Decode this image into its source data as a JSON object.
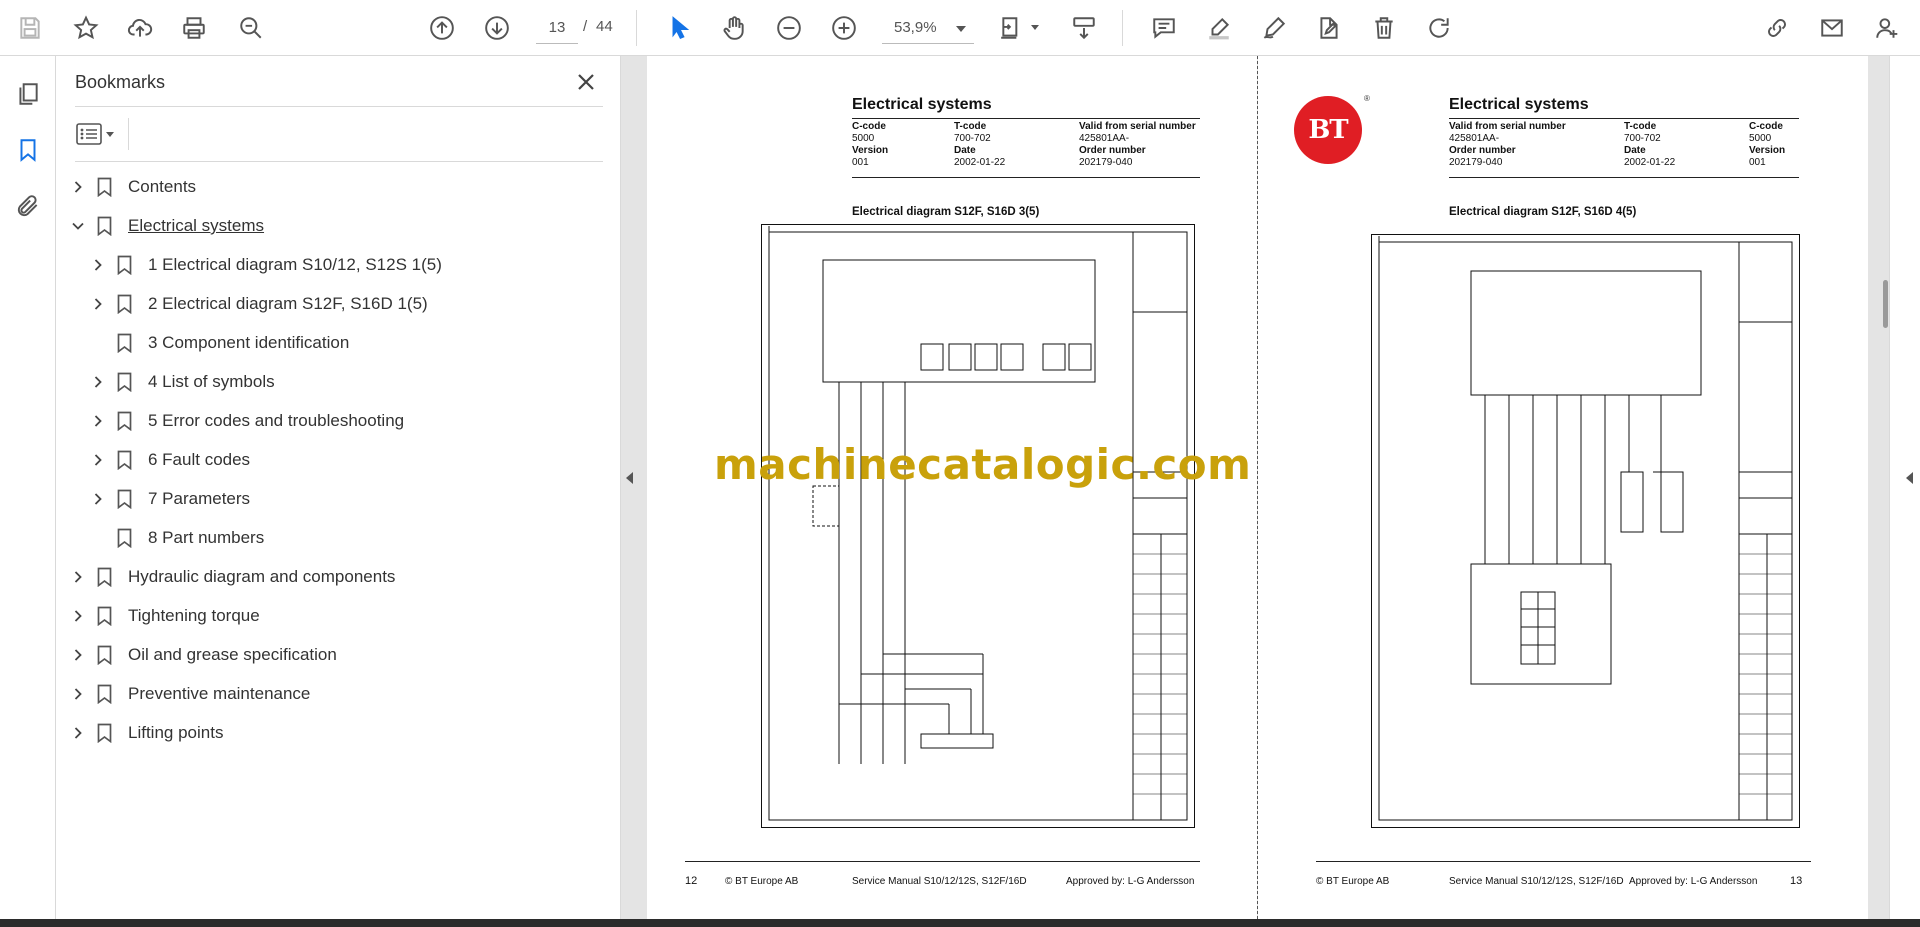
{
  "toolbar": {
    "page_current": "13",
    "page_separator": "/",
    "page_total": "44",
    "zoom": "53,9%"
  },
  "panel": {
    "title": "Bookmarks",
    "items": [
      {
        "label": "Contents",
        "level": 0,
        "expandable": true,
        "expanded": false
      },
      {
        "label": "Electrical systems",
        "level": 0,
        "expandable": true,
        "expanded": true
      },
      {
        "label": "1 Electrical diagram S10/12, S12S 1(5)",
        "level": 1,
        "expandable": true,
        "expanded": false
      },
      {
        "label": "2 Electrical diagram S12F, S16D 1(5)",
        "level": 1,
        "expandable": true,
        "expanded": false
      },
      {
        "label": "3 Component identification",
        "level": 1,
        "expandable": false,
        "expanded": false
      },
      {
        "label": "4 List of symbols",
        "level": 1,
        "expandable": true,
        "expanded": false
      },
      {
        "label": "5 Error codes and troubleshooting",
        "level": 1,
        "expandable": true,
        "expanded": false
      },
      {
        "label": "6 Fault codes",
        "level": 1,
        "expandable": true,
        "expanded": false
      },
      {
        "label": "7 Parameters",
        "level": 1,
        "expandable": true,
        "expanded": false
      },
      {
        "label": "8 Part numbers",
        "level": 1,
        "expandable": false,
        "expanded": false
      },
      {
        "label": "Hydraulic diagram and components",
        "level": 0,
        "expandable": true,
        "expanded": false
      },
      {
        "label": "Tightening torque",
        "level": 0,
        "expandable": true,
        "expanded": false
      },
      {
        "label": "Oil and grease specification",
        "level": 0,
        "expandable": true,
        "expanded": false
      },
      {
        "label": "Preventive maintenance",
        "level": 0,
        "expandable": true,
        "expanded": false
      },
      {
        "label": "Lifting points",
        "level": 0,
        "expandable": true,
        "expanded": false
      }
    ]
  },
  "left_page": {
    "section": "Electrical systems",
    "meta": {
      "c1": [
        "C-code",
        "5000",
        "Version",
        "001"
      ],
      "c2": [
        "T-code",
        "700-702",
        "Date",
        "2002-01-22"
      ],
      "c3": [
        "Valid from serial number",
        "425801AA-",
        "Order number",
        "202179-040"
      ]
    },
    "diagram_title": "Electrical diagram S12F, S16D 3(5)",
    "footer": {
      "page_number": "12",
      "copyright": "© BT Europe AB",
      "manual": "Service Manual S10/12/12S, S12F/16D",
      "approved": "Approved by: L-G Andersson"
    }
  },
  "right_page": {
    "section": "Electrical systems",
    "logo": "BT",
    "logo_mark": "®",
    "meta": {
      "c1": [
        "Valid from serial number",
        "425801AA-",
        "Order number",
        "202179-040"
      ],
      "c2": [
        "T-code",
        "700-702",
        "Date",
        "2002-01-22"
      ],
      "c3": [
        "C-code",
        "5000",
        "Version",
        "001"
      ]
    },
    "diagram_title": "Electrical diagram S12F, S16D 4(5)",
    "footer": {
      "page_number": "13",
      "copyright": "© BT Europe AB",
      "manual": "Service Manual S10/12/12S, S12F/16D",
      "approved": "Approved by: L-G Andersson"
    }
  },
  "watermark": "machinecatalogic.com",
  "colors": {
    "accent": "#1473e6",
    "logo_red": "#e01e24",
    "watermark": "#c9a10b"
  }
}
